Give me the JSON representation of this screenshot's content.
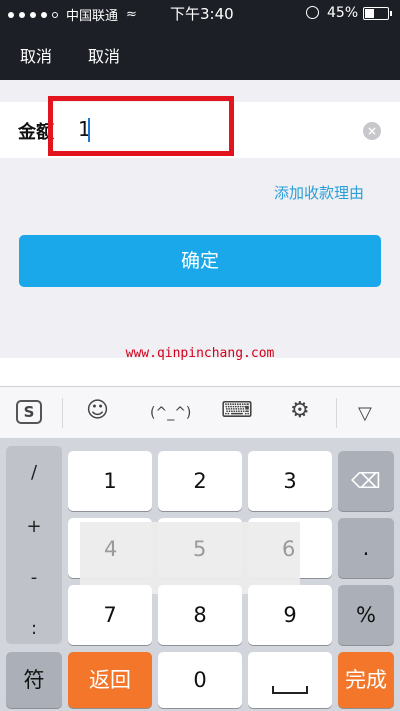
{
  "status": {
    "carrier": "中国联通",
    "time": "下午3:40",
    "battery": "45%"
  },
  "nav": {
    "left1": "取消",
    "left2": "取消"
  },
  "form": {
    "amount_label": "金额",
    "amount_value": "1",
    "add_reason": "添加收款理由",
    "confirm": "确定"
  },
  "watermark": "www.qinpinchang.com",
  "keyboard": {
    "toolbar": [
      "S",
      "☺",
      "(^_^)",
      "⌨",
      "⚙",
      "▽"
    ],
    "symbols": [
      "/",
      "+",
      "-",
      ":"
    ],
    "digits_row1": [
      "1",
      "2",
      "3"
    ],
    "digits_row2": [
      "4",
      "5",
      "6"
    ],
    "digits_row3": [
      "7",
      "8",
      "9"
    ],
    "bottom": {
      "symbol_key": "符",
      "back": "返回",
      "zero": "0",
      "space": "␣",
      "done": "完成"
    },
    "right_keys": {
      "backspace": "⌫",
      "dot": ".",
      "percent": "%"
    }
  }
}
